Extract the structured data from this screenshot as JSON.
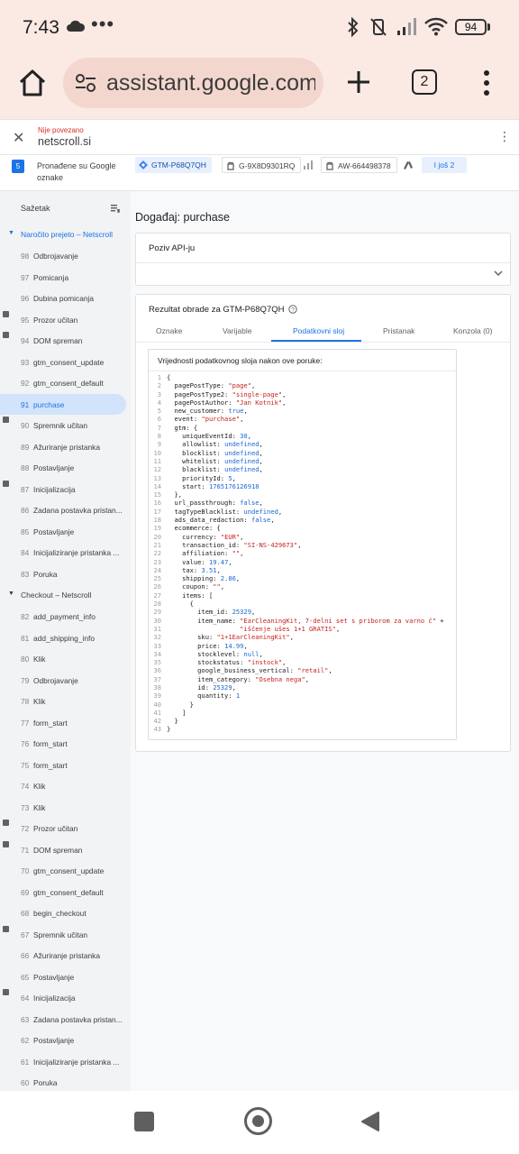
{
  "status_bar": {
    "time": "7:43",
    "dots": "•••",
    "battery": "94"
  },
  "browser": {
    "url": "assistant.google.com",
    "tab_count": "2"
  },
  "tag_assistant": {
    "connection_status": "Nije povezano",
    "domain": "netscroll.si",
    "found_tags_count": "5",
    "found_tags_label": "Pronađene su Google oznake",
    "chips": {
      "gtm": "GTM-P68Q7QH",
      "ga": "G-9X8D9301RQ",
      "aw": "AW-664498378",
      "more": "I još 2"
    }
  },
  "sidebar": {
    "summary": "Sažetak",
    "group1_title": "Naročilo prejeto – Netscroll",
    "group2_title": "Checkout – Netscroll",
    "group1_events": [
      {
        "num": "98",
        "name": "Odbrojavanje",
        "badge": false
      },
      {
        "num": "97",
        "name": "Pomicanja",
        "badge": false
      },
      {
        "num": "96",
        "name": "Dubina pomicanja",
        "badge": false
      },
      {
        "num": "95",
        "name": "Prozor učitan",
        "badge": true
      },
      {
        "num": "94",
        "name": "DOM spreman",
        "badge": true
      },
      {
        "num": "93",
        "name": "gtm_consent_update",
        "badge": false
      },
      {
        "num": "92",
        "name": "gtm_consent_default",
        "badge": false
      },
      {
        "num": "91",
        "name": "purchase",
        "badge": false,
        "active": true
      },
      {
        "num": "90",
        "name": "Spremnik učitan",
        "badge": true
      },
      {
        "num": "89",
        "name": "Ažuriranje pristanka",
        "badge": false
      },
      {
        "num": "88",
        "name": "Postavljanje",
        "badge": false
      },
      {
        "num": "87",
        "name": "Inicijalizacija",
        "badge": true
      },
      {
        "num": "86",
        "name": "Zadana postavka pristan...",
        "badge": false
      },
      {
        "num": "85",
        "name": "Postavljanje",
        "badge": false
      },
      {
        "num": "84",
        "name": "Inicijaliziranje pristanka ...",
        "badge": false
      },
      {
        "num": "83",
        "name": "Poruka",
        "badge": false
      }
    ],
    "group2_events": [
      {
        "num": "82",
        "name": "add_payment_info",
        "badge": false
      },
      {
        "num": "81",
        "name": "add_shipping_info",
        "badge": false
      },
      {
        "num": "80",
        "name": "Klik",
        "badge": false
      },
      {
        "num": "79",
        "name": "Odbrojavanje",
        "badge": false
      },
      {
        "num": "78",
        "name": "Klik",
        "badge": false
      },
      {
        "num": "77",
        "name": "form_start",
        "badge": false
      },
      {
        "num": "76",
        "name": "form_start",
        "badge": false
      },
      {
        "num": "75",
        "name": "form_start",
        "badge": false
      },
      {
        "num": "74",
        "name": "Klik",
        "badge": false
      },
      {
        "num": "73",
        "name": "Klik",
        "badge": false
      },
      {
        "num": "72",
        "name": "Prozor učitan",
        "badge": true
      },
      {
        "num": "71",
        "name": "DOM spreman",
        "badge": true
      },
      {
        "num": "70",
        "name": "gtm_consent_update",
        "badge": false
      },
      {
        "num": "69",
        "name": "gtm_consent_default",
        "badge": false
      },
      {
        "num": "68",
        "name": "begin_checkout",
        "badge": false
      },
      {
        "num": "67",
        "name": "Spremnik učitan",
        "badge": true
      },
      {
        "num": "66",
        "name": "Ažuriranje pristanka",
        "badge": false
      },
      {
        "num": "65",
        "name": "Postavljanje",
        "badge": false
      },
      {
        "num": "64",
        "name": "Inicijalizacija",
        "badge": true
      },
      {
        "num": "63",
        "name": "Zadana postavka pristan...",
        "badge": false
      },
      {
        "num": "62",
        "name": "Postavljanje",
        "badge": false
      },
      {
        "num": "61",
        "name": "Inicijaliziranje pristanka ...",
        "badge": false
      },
      {
        "num": "60",
        "name": "Poruka",
        "badge": false
      }
    ]
  },
  "main": {
    "event_title": "Događaj: purchase",
    "api_title": "Poziv API-ju",
    "result_title": "Rezultat obrade za GTM-P68Q7QH",
    "tabs": [
      "Oznake",
      "Varijable",
      "Podatkovni sloj",
      "Pristanak",
      "Konzola (0)"
    ],
    "dl_header": "Vrijednosti podatkovnog sloja nakon ove poruke:",
    "code_lines": [
      "{",
      "  pagePostType: \"page\",",
      "  pagePostType2: \"single-page\",",
      "  pagePostAuthor: \"Jan Kotnik\",",
      "  new_customer: true,",
      "  event: \"purchase\",",
      "  gtm: {",
      "    uniqueEventId: 30,",
      "    allowlist: undefined,",
      "    blocklist: undefined,",
      "    whitelist: undefined,",
      "    blacklist: undefined,",
      "    priorityId: 5,",
      "    start: 1765176126918",
      "  },",
      "  url_passthrough: false,",
      "  tagTypeBlacklist: undefined,",
      "  ads_data_redaction: false,",
      "  ecommerce: {",
      "    currency: \"EUR\",",
      "    transaction_id: \"SI-NS-429673\",",
      "    affiliation: \"\",",
      "    value: 19.47,",
      "    tax: 3.51,",
      "    shipping: 2.86,",
      "    coupon: \"\",",
      "    items: [",
      "      {",
      "        item_id: 25329,",
      "        item_name: \"EarCleaningKit, 7-delni set s priborom za varno č\" +",
      "                   \"iščenje ušes 1+1 GRATIS\",",
      "        sku: \"1+1EarCleaningKit\",",
      "        price: 14.99,",
      "        stocklevel: null,",
      "        stockstatus: \"instock\",",
      "        google_business_vertical: \"retail\",",
      "        item_category: \"Osebna nega\",",
      "        id: 25329,",
      "        quantity: 1",
      "      }",
      "    ]",
      "  }",
      "}"
    ]
  },
  "colors": {
    "accent": "#1a73e8",
    "chrome": "#fbe9e4",
    "sidebar_bg": "#f1f3f4",
    "error": "#d93025"
  }
}
